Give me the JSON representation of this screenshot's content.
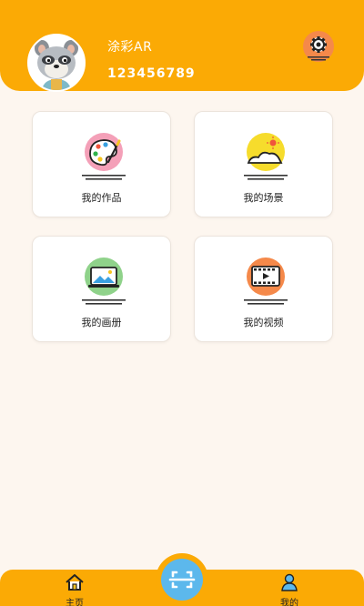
{
  "user": {
    "name": "涂彩AR",
    "id": "123456789"
  },
  "cards": [
    {
      "label": "我的作品",
      "icon": "palette-icon",
      "color": "#f4a0b8"
    },
    {
      "label": "我的场景",
      "icon": "landscape-icon",
      "color": "#f6dc2c"
    },
    {
      "label": "我的画册",
      "icon": "album-icon",
      "color": "#8fd28a"
    },
    {
      "label": "我的视频",
      "icon": "video-icon",
      "color": "#f5894a"
    }
  ],
  "nav": {
    "home_label": "主页",
    "mine_label": "我的"
  },
  "colors": {
    "brand": "#fbaa05",
    "background": "#fdf6ef"
  }
}
